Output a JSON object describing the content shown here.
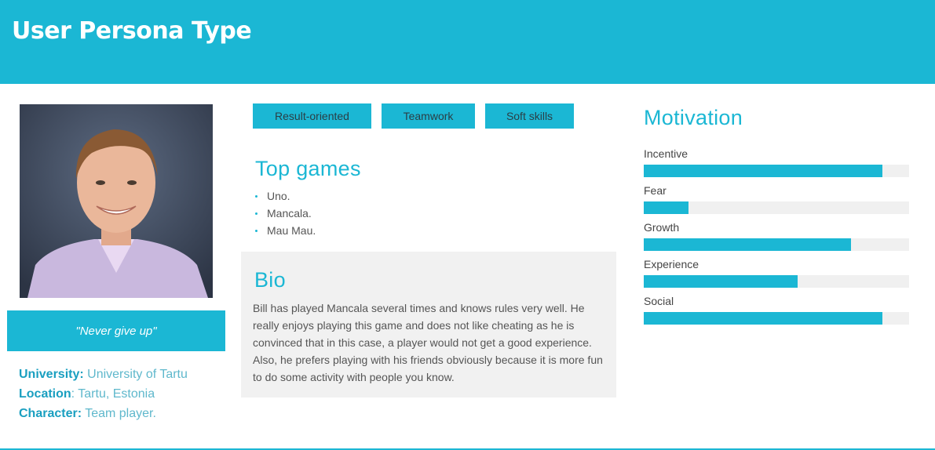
{
  "header": {
    "title": "User Persona Type"
  },
  "profile": {
    "quote": "\"Never give up\"",
    "university_key": "University:",
    "university_val": " University of Tartu",
    "location_key": "Location",
    "location_val": ": Tartu, Estonia",
    "character_key": "Character:",
    "character_val": " Team player."
  },
  "tags": [
    "Result-oriented",
    "Teamwork",
    "Soft skills"
  ],
  "games": {
    "title": "Top games",
    "items": [
      "Uno.",
      "Mancala.",
      "Mau Mau."
    ]
  },
  "bio": {
    "title": "Bio",
    "text": "Bill has played Mancala several times and knows rules very well. He really enjoys playing this game and does not like cheating as he is convinced that in this case, a player would not get a good experience. Also, he prefers playing with his friends obviously because it is more fun to do some activity with people you know."
  },
  "motivation": {
    "title": "Motivation",
    "items": [
      {
        "label": "Incentive",
        "value": 0.9
      },
      {
        "label": "Fear",
        "value": 0.17
      },
      {
        "label": "Growth",
        "value": 0.78
      },
      {
        "label": "Experience",
        "value": 0.58
      },
      {
        "label": "Social",
        "value": 0.9
      }
    ]
  },
  "colors": {
    "accent": "#1bb7d4",
    "bar_track": "#f0f0f0",
    "bio_bg": "#f1f1f1"
  }
}
